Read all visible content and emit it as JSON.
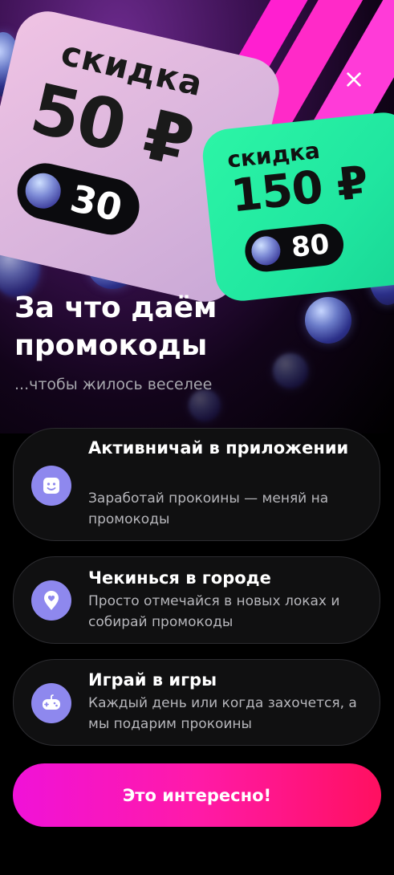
{
  "hero": {
    "card_small": {
      "label": "скидка",
      "amount": "50 ₽",
      "coins": "30"
    },
    "card_large": {
      "label": "скидка",
      "amount": "150 ₽",
      "coins": "80"
    }
  },
  "header": {
    "title": "За что даём промокоды",
    "subtitle": "...чтобы жилось веселее"
  },
  "features": [
    {
      "title": "Активничай в приложении",
      "description": "Заработай прокоины — меняй на промокоды",
      "icon": "smile-app-icon"
    },
    {
      "title": "Чекинься в городе",
      "description": "Просто отмечайся в новых локах и собирай промокоды",
      "icon": "map-pin-heart-icon"
    },
    {
      "title": "Играй в игры",
      "description": "Каждый день или когда захочется, а мы подарим прокоины",
      "icon": "gamepad-icon"
    }
  ],
  "cta": {
    "label": "Это интересно!"
  },
  "colors": {
    "accent_gradient_start": "#f012d8",
    "accent_gradient_end": "#ff1060",
    "icon_bg": "#8e88ee",
    "card_green": "#20e6a0",
    "card_pink": "#e6b8e0"
  }
}
